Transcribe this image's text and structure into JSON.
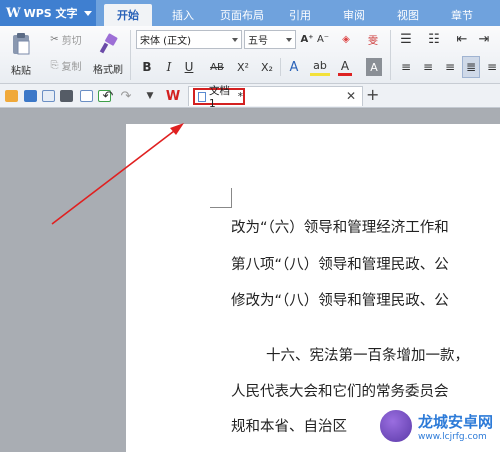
{
  "app": {
    "name": "WPS 文字"
  },
  "tabs": [
    {
      "label": "开始",
      "active": true
    },
    {
      "label": "插入"
    },
    {
      "label": "页面布局"
    },
    {
      "label": "引用"
    },
    {
      "label": "审阅"
    },
    {
      "label": "视图"
    },
    {
      "label": "章节"
    }
  ],
  "ribbon": {
    "paste_label": "粘贴",
    "cut_label": "剪切",
    "copy_label": "复制",
    "format_painter_label": "格式刷",
    "font_name": "宋体 (正文)",
    "font_size": "五号",
    "bold": "B",
    "italic": "I",
    "underline": "U",
    "strikethrough": "AB",
    "superscript": "X²",
    "subscript": "X₂",
    "grow_font": "A⁺",
    "shrink_font": "A⁻",
    "text_effect": "A",
    "highlight": "ab",
    "font_color": "A",
    "char_shading": "A"
  },
  "document": {
    "tab_name": "文档1",
    "lines": [
      "改为“（六）领导和管理经济工作和",
      "第八项“（八）领导和管理民政、公",
      "修改为“（八）领导和管理民政、公",
      "十六、宪法第一百条增加一款，",
      "人民代表大会和它们的常务委员会",
      "规和本省、自治区"
    ]
  },
  "watermark": {
    "brand": "龙城安卓网",
    "url": "www.lcjrfg.com"
  },
  "colors": {
    "accent": "#3f7fd0",
    "annotation": "#d32020"
  }
}
